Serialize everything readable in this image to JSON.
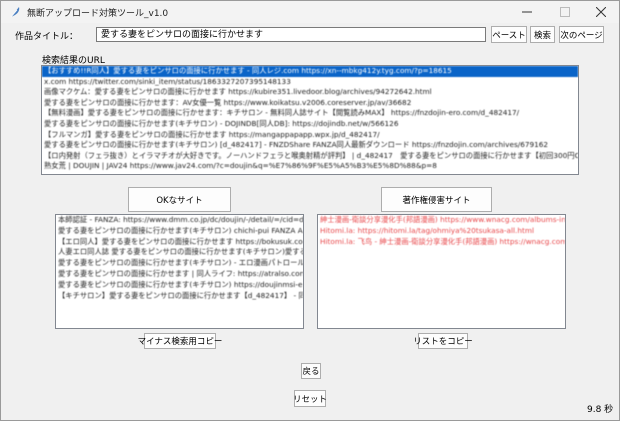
{
  "window": {
    "title": "無断アップロード対策ツール_v1.0",
    "accent": "#0a64c8"
  },
  "controls": {
    "minimize_icon": "minimize-icon",
    "maximize_icon": "maximize-icon",
    "close_icon": "close-icon"
  },
  "form": {
    "title_label": "作品タイトル：",
    "title_value": "愛する妻をピンサロの面接に行かせます",
    "paste_label": "ペースト",
    "search_label": "検索",
    "next_page_label": "次のページ"
  },
  "results": {
    "label": "検索結果のURL",
    "items": [
      "【おすすめ!!R同人】愛する妻をピンサロの面接に行かせます - 同人レジ.com https://xn--mbkg412y.tyg.com/?p=18615",
      "x.com https://twitter.com/sinki_item/status/1863327207395148133",
      "画像マクケム：愛する妻をピンサロの面接に行かせます https://kubire351.livedoor.blog/archives/94272642.html",
      "愛する妻をピンサロの面接に行かせます：AV女優一覧 https://www.koikatsu.v2006.coreserver.jp/av/36682",
      "【無料漫画】愛する妻をピンサロの面接に行かせます：キチサロン - 無料同人誌サイト【閲覧読みMAX】 https://fnzdojin-ero.com/d_482417/",
      "愛する妻をピンサロの面接に行かせます(キチサロン) - DOJINDB[同人DB]: https://dojindb.net/w/566126",
      "【フルマンガ】愛する妻をピンサロの面接に行かせます https://mangappapapp.wpx.jp/d_482417/",
      "愛する妻をピンサロの面接に行かせます(キチサロン) [d_482417] - FNZDShare FANZA同人最新ダウンロード https://fnzdojin.com/archives/679162",
      "【ロ内発射（フェラ抜き）とイラマチオが大好きです。ノーハンドフェラと喉奥射精が評判】 | d_482417　愛する妻をピンサロの面接に行かせます【初回300円OFF】 https://www.fanza.com/?",
      "熟女荒 | DOUJIN | JAV24 https://www.jav24.com/?c=doujin&q=%E7%86%9F%E5%A5%B3%E5%8D%88&p=8"
    ]
  },
  "ok_button_label": "OKなサイト",
  "ng_button_label": "著作権侵害サイト",
  "ok_list": {
    "items": [
      "本師認証 - FANZA: https://www.dmm.co.jp/dc/doujin/-/detail/=/cid=d_482417/",
      "愛する妻をピンサロの面接に行かせます(キチサロン) chichi-pui FANZA AI: https://",
      "【エロ同人】愛する妻をピンサロの面接に行かせます https://bokusuk.com/",
      "人妻エロ同人誌 愛する妻をピンサロの面接に行かせます(キチサロン)愛する妻をピンサロの面接に行かせます(整備) 漫画",
      "愛する妻をピンサロの面接に行かせます(キチサロン) - エロ漫画パトロール: https://",
      "愛する妻をピンサロの面接に行かせます | 同人ライフ: https://atralso.com/d_482417/",
      "愛する妻をピンサロの面接に行かせます(キチサロン) https://doujinmsi-ero.com/",
      "【キチサロン】愛する妻をピンサロの面接に行かせます【d_482417】 - 同人の森"
    ]
  },
  "ng_list": {
    "items": [
      "紳士漫画-衛談分享漫化手(邦語漫画) https://www.wnacg.com/albums-index-aid-333.html",
      "Hitomi.la: https://hitomi.la/tag/ohmiya%20tsukasa-all.html",
      "Hitomi.la: 飞鸟 - 紳士漫画-衛談分享漫化手(邦語漫画) https://wnacg.com/"
    ]
  },
  "minus_copy_label": "マイナス検索用コピー",
  "list_copy_label": "リストをコピー",
  "back_label": "戻る",
  "reset_label": "リセット",
  "elapsed": "9.8 秒"
}
